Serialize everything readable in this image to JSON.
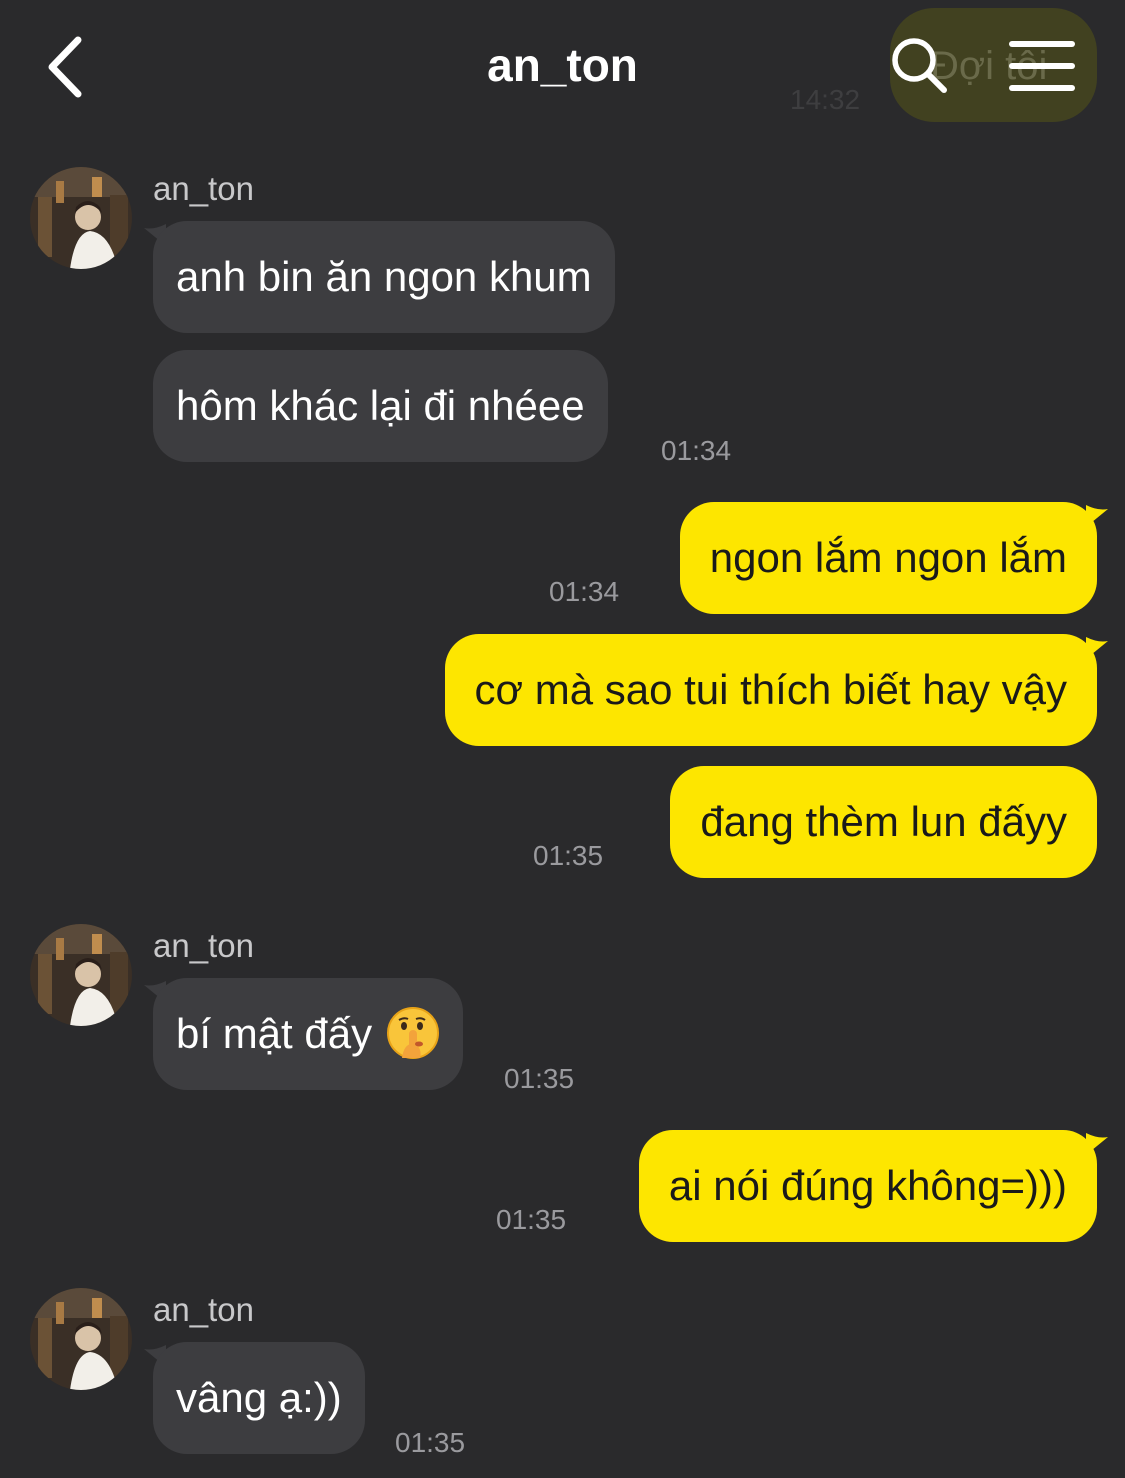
{
  "header": {
    "title": "an_ton",
    "back_icon": "chevron-left-icon",
    "search_icon": "search-icon",
    "menu_icon": "hamburger-menu-icon"
  },
  "ghost": {
    "text": "Đợi tôi",
    "time": "14:32"
  },
  "colors": {
    "background": "#2a2a2c",
    "incoming_bubble": "#3d3d40",
    "outgoing_bubble": "#fde600",
    "timestamp": "#9a9a9e"
  },
  "messages": [
    {
      "sender_name": "an_ton",
      "text": "anh bin ăn ngon khum"
    },
    {
      "text": "hôm khác lại đi nhéee",
      "time": "01:34"
    },
    {
      "text": "ngon lắm ngon lắm",
      "time": "01:34"
    },
    {
      "text": "cơ mà sao tui thích biết hay vậy"
    },
    {
      "text": "đang thèm lun đấyy",
      "time": "01:35"
    },
    {
      "sender_name": "an_ton",
      "text": "bí mật đấy",
      "emoji": "shushing-face-emoji",
      "time": "01:35"
    },
    {
      "text": "ai nói đúng không=)))",
      "time": "01:35"
    },
    {
      "sender_name": "an_ton",
      "text": "vâng ạ:))",
      "time": "01:35"
    }
  ]
}
